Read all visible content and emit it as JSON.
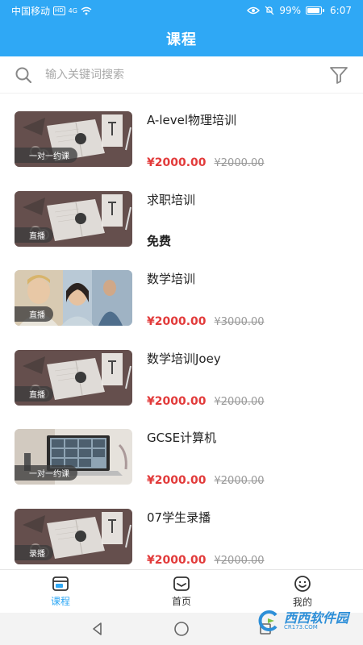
{
  "status_bar": {
    "carrier": "中国移动",
    "hd": "HD",
    "network": "4G",
    "battery_text": "99%",
    "battery_level": 0.99,
    "time": "6:07"
  },
  "header": {
    "title": "课程"
  },
  "search": {
    "placeholder": "输入关键词搜索"
  },
  "courses": [
    {
      "title": "A-level物理培训",
      "tag": "一对一约课",
      "price": "¥2000.00",
      "original_price": "¥2000.00",
      "thumb": "desk"
    },
    {
      "title": "求职培训",
      "tag": "直播",
      "free_label": "免费",
      "thumb": "desk"
    },
    {
      "title": "数学培训",
      "tag": "直播",
      "price": "¥2000.00",
      "original_price": "¥3000.00",
      "thumb": "people"
    },
    {
      "title": "数学培训Joey",
      "tag": "直播",
      "price": "¥2000.00",
      "original_price": "¥2000.00",
      "thumb": "desk"
    },
    {
      "title": "GCSE计算机",
      "tag": "一对一约课",
      "price": "¥2000.00",
      "original_price": "¥2000.00",
      "thumb": "laptop"
    },
    {
      "title": "07学生录播",
      "tag": "录播",
      "price": "¥2000.00",
      "original_price": "¥2000.00",
      "thumb": "desk"
    }
  ],
  "bottom_nav": {
    "items": [
      {
        "label": "课程",
        "icon": "course-icon",
        "active": true
      },
      {
        "label": "首页",
        "icon": "home-icon",
        "active": false
      },
      {
        "label": "我的",
        "icon": "smile-icon",
        "active": false
      }
    ]
  },
  "watermark": {
    "text": "西西软件园",
    "sub": "CR173.COM"
  },
  "colors": {
    "primary": "#2fa8f5",
    "price": "#e23b3b"
  }
}
